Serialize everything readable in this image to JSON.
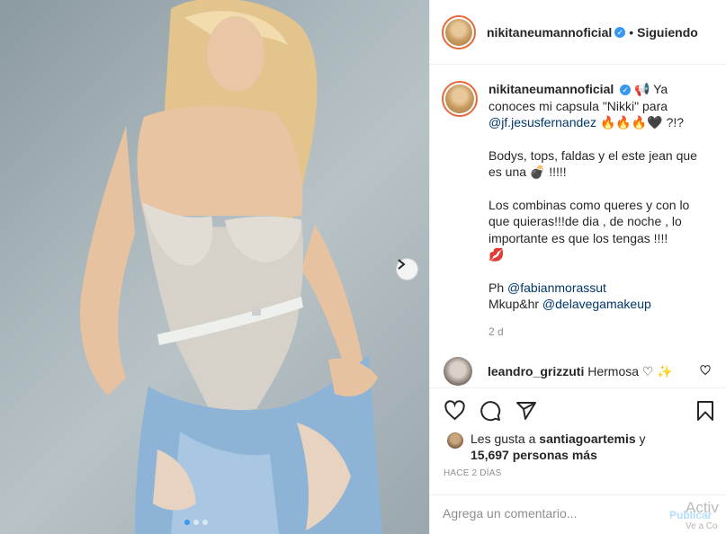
{
  "post": {
    "username": "nikitaneumannoficial",
    "verified_mark": "✓",
    "separator": "•",
    "follow_label": "Siguiendo",
    "caption_lines": [
      "📢 Ya conoces mi capsula \"Nikki\" para",
      "@jf.jesusfernandez",
      "🔥🔥🔥🖤 ?!?",
      "Bodys, tops, faldas y el este jean que es una 💣 !!!!!",
      "Los combinas como queres y con lo que quieras!!!de dia , de noche , lo importante es que los tengas !!!!",
      "💋",
      "Ph",
      "@fabianmorassut",
      "Mkup&hr",
      "@delavegamakeup"
    ],
    "age": "2 d"
  },
  "comment": {
    "username": "leandro_grizzuti",
    "text": "Hermosa ♡ ✨"
  },
  "actions": {
    "like_icon": "heart-icon",
    "comment_icon": "comment-icon",
    "share_icon": "share-icon",
    "save_icon": "bookmark-icon"
  },
  "likes": {
    "prefix": "Les gusta a",
    "user": "santiagoartemis",
    "conj": "y",
    "count": "15,697 personas más"
  },
  "date_label": "HACE 2 DÍAS",
  "composer": {
    "placeholder": "Agrega un comentario...",
    "publish_label": "Publicar"
  },
  "watermark": {
    "line1": "Activ",
    "line2": "Ve a Co"
  },
  "carousel": {
    "current": 1,
    "total": 3
  }
}
